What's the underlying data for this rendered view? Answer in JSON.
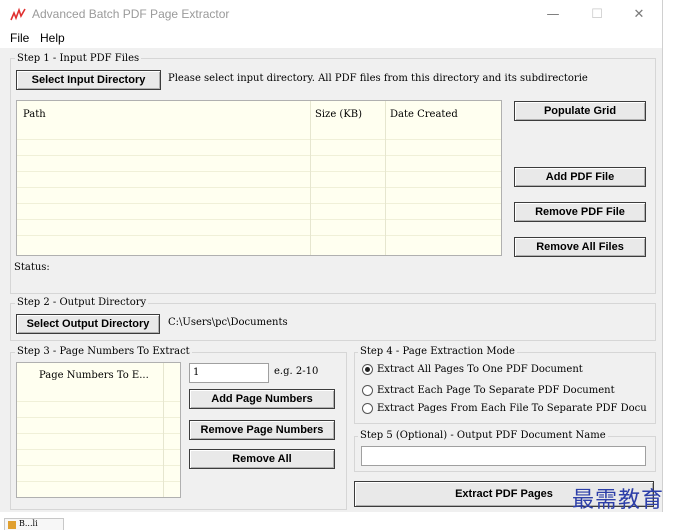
{
  "window": {
    "title": "Advanced Batch PDF Page Extractor",
    "minimize": "—",
    "maximize": "☐",
    "close": "✕"
  },
  "menu": {
    "file": "File",
    "help": "Help"
  },
  "step1": {
    "label": "Step 1 - Input PDF Files",
    "select_button": "Select Input Directory",
    "hint": "Please select input directory. All PDF files from this directory and its subdirectorie",
    "columns": [
      "Path",
      "Size (KB)",
      "Date Created"
    ],
    "populate_button": "Populate Grid",
    "add_button": "Add PDF File",
    "remove_button": "Remove PDF File",
    "remove_all_button": "Remove All Files",
    "status_label": "Status:"
  },
  "step2": {
    "label": "Step 2 - Output Directory",
    "select_button": "Select Output Directory",
    "path": "C:\\Users\\pc\\Documents"
  },
  "step3": {
    "label": "Step 3 - Page Numbers To Extract",
    "list_header": "Page Numbers To E...",
    "input_value": "1",
    "example": "e.g. 2-10",
    "add_button": "Add Page Numbers",
    "remove_button": "Remove Page Numbers",
    "remove_all_button": "Remove All"
  },
  "step4": {
    "label": "Step 4 - Page Extraction Mode",
    "options": [
      {
        "label": "Extract All Pages To One PDF Document",
        "selected": true
      },
      {
        "label": "Extract Each Page To Separate PDF Document",
        "selected": false
      },
      {
        "label": "Extract Pages From Each File To Separate PDF Docu",
        "selected": false
      }
    ]
  },
  "step5": {
    "label": "Step 5 (Optional) - Output PDF Document Name",
    "value": ""
  },
  "extract_button": "Extract PDF Pages",
  "watermark": "最需教育",
  "taskbar_label": "B...li"
}
